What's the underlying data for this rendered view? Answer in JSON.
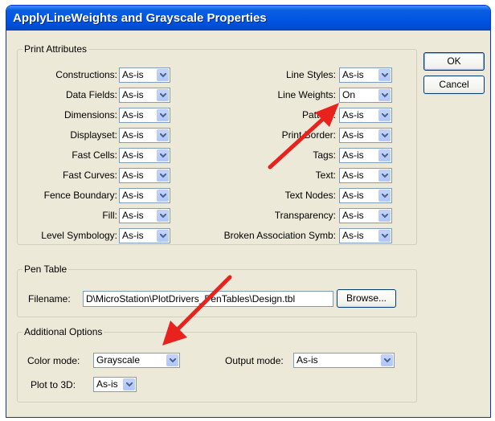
{
  "window": {
    "title": "ApplyLineWeights and Grayscale Properties"
  },
  "print_attributes": {
    "title": "Print Attributes",
    "left": [
      {
        "label": "Constructions:",
        "value": "As-is"
      },
      {
        "label": "Data Fields:",
        "value": "As-is"
      },
      {
        "label": "Dimensions:",
        "value": "As-is"
      },
      {
        "label": "Displayset:",
        "value": "As-is"
      },
      {
        "label": "Fast Cells:",
        "value": "As-is"
      },
      {
        "label": "Fast Curves:",
        "value": "As-is"
      },
      {
        "label": "Fence Boundary:",
        "value": "As-is"
      },
      {
        "label": "Fill:",
        "value": "As-is"
      },
      {
        "label": "Level Symbology:",
        "value": "As-is"
      }
    ],
    "right": [
      {
        "label": "Line Styles:",
        "value": "As-is"
      },
      {
        "label": "Line Weights:",
        "value": "On"
      },
      {
        "label": "Pattern:",
        "value": "As-is"
      },
      {
        "label": "Print Border:",
        "value": "As-is"
      },
      {
        "label": "Tags:",
        "value": "As-is"
      },
      {
        "label": "Text:",
        "value": "As-is"
      },
      {
        "label": "Text Nodes:",
        "value": "As-is"
      },
      {
        "label": "Transparency:",
        "value": "As-is"
      },
      {
        "label": "Broken Association Symb:",
        "value": "As-is"
      }
    ]
  },
  "buttons": {
    "ok": "OK",
    "cancel": "Cancel",
    "browse": "Browse..."
  },
  "pen_table": {
    "title": "Pen Table",
    "filename_label": "Filename:",
    "filename_value": "D\\MicroStation\\PlotDrivers_PenTables\\Design.tbl"
  },
  "additional_options": {
    "title": "Additional Options",
    "color_mode_label": "Color mode:",
    "color_mode_value": "Grayscale",
    "output_mode_label": "Output mode:",
    "output_mode_value": "As-is",
    "plot3d_label": "Plot to 3D:",
    "plot3d_value": "As-is"
  },
  "annotation_color": "#e8231e"
}
